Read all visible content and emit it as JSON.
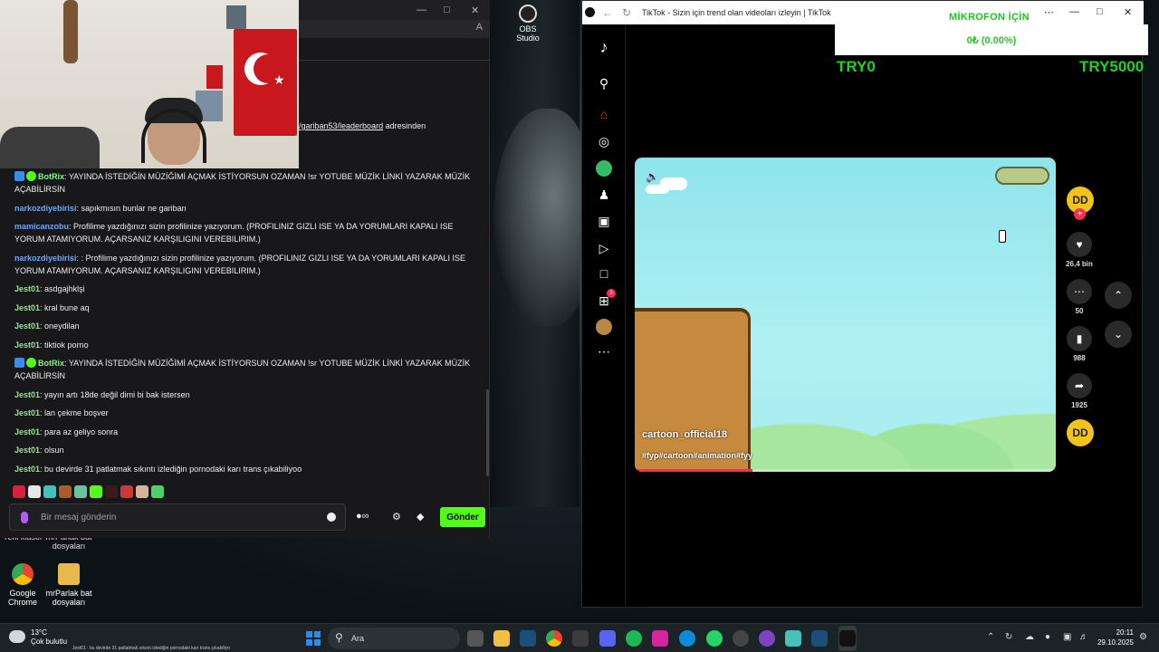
{
  "desktop": {
    "obs_label": "OBS Studio",
    "icons": [
      {
        "label": "Google Chrome",
        "color": "#4285f4"
      },
      {
        "label": "mrParlak bat dosyaları",
        "color": "#e8b84a"
      }
    ],
    "partial_icons": [
      "Yeni klasör",
      "mrParlak bat dosyaları"
    ]
  },
  "chat": {
    "leaderboard_link": "/gariban53/leaderboard",
    "leaderboard_suffix": " adresinden",
    "messages": [
      {
        "user": "BotRix",
        "type": "bot",
        "text": "YAYINDA İSTEDİĞİN MÜZİĞİMİ AÇMAK İSTİYORSUN OZAMAN !sr YOTUBE MÜZİK LİNKİ YAZARAK MÜZİK AÇABİLİRSİN"
      },
      {
        "user": "narkozdiyebirisi",
        "type": "nark",
        "text": "sapıkmısın bunlar ne gariban"
      },
      {
        "user": "mamicanzobu",
        "type": "mami",
        "text": "Profilime yazdığınızı sizin profilinize yazıyorum. (PROFILINIZ GIZLI ISE YA DA YORUMLARI KAPALI ISE YORUM ATAMIYORUM. AÇARSANIZ KARŞILIGINI VEREBILIRIM.)"
      },
      {
        "user": "narkozdiyebirisi",
        "type": "nark",
        "text": ": Profilime yazdığınızı sizin profilinize yazıyorum. (PROFILINIZ GIZLI ISE YA DA YORUMLARI KAPALI ISE YORUM ATAMIYORUM. AÇARSANIZ KARŞILIGINI VEREBILIRIM.)"
      },
      {
        "user": "Jest01",
        "type": "jest",
        "text": "asdgajhklşi"
      },
      {
        "user": "Jest01",
        "type": "jest",
        "text": "kral bune aq"
      },
      {
        "user": "Jest01",
        "type": "jest",
        "text": "oneydilan"
      },
      {
        "user": "Jest01",
        "type": "jest",
        "text": "tiktiok porno"
      },
      {
        "user": "BotRix",
        "type": "bot",
        "text": "YAYINDA İSTEDİĞİN MÜZİĞİMİ AÇMAK İSTİYORSUN OZAMAN !sr YOTUBE MÜZİK LİNKİ YAZARAK MÜZİK AÇABİLİRSİN"
      },
      {
        "user": "Jest01",
        "type": "jest",
        "text": "yayın artı 18de değil dimi bi bak istersen"
      },
      {
        "user": "Jest01",
        "type": "jest",
        "text": "lan çekme boşver"
      },
      {
        "user": "Jest01",
        "type": "jest",
        "text": "para az geliyo sonra"
      },
      {
        "user": "Jest01",
        "type": "jest",
        "text": "olsun"
      },
      {
        "user": "Jest01",
        "type": "jest",
        "text": "bu devirde 31 patlatmak sıkıntı izlediğin pornodaki karı trans çıkabiliyoo"
      }
    ],
    "input_placeholder": "Bir mesaj gönderin",
    "send_label": "Gönder",
    "accent": "#53fc18"
  },
  "tiktok": {
    "window_title": "TikTok - Sizin için trend olan videoları izleyin | TikTok",
    "notif_count": "3",
    "video": {
      "handle": "cartoon_official18",
      "tags": "#fyp#cartoon#animation#fyy",
      "progress": 0.28
    },
    "actions": {
      "likes": "26,4 bin",
      "comments": "50",
      "saves": "988",
      "shares": "1925"
    },
    "avatar_text": "DD"
  },
  "donation": {
    "mikrofon": "MİKROFON İÇİN",
    "percent": "0₺ (0.00%)",
    "left": "TRY0",
    "right": "TRY5000"
  },
  "taskbar": {
    "temp": "13°C",
    "weather": "Çok bulutlu",
    "search": "Ara",
    "ticker": "Jest01 : bu devirde 31 patlatmak sıkıntı izlediğin pornodaki karı trans çıkabiliyo",
    "time": "20:11",
    "date": "29.10.2025"
  }
}
